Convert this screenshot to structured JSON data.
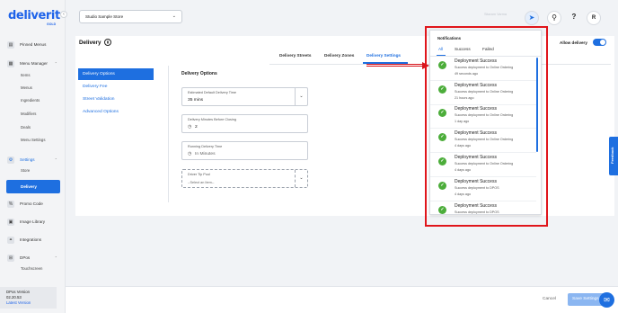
{
  "sidebar": {
    "logo": "deliverit",
    "logo_sub": "GOLD",
    "items": [
      {
        "label": "Pinned Menus",
        "icon": "pin-icon"
      },
      {
        "label": "Menu Manager",
        "icon": "menu-icon"
      },
      {
        "label": "Settings",
        "icon": "gear-icon"
      },
      {
        "label": "Promo Code",
        "icon": "promo-icon"
      },
      {
        "label": "Image Library",
        "icon": "image-icon"
      },
      {
        "label": "Integrations",
        "icon": "integrations-icon"
      },
      {
        "label": "DPos",
        "icon": "dpos-icon"
      }
    ],
    "menu_manager_sub": [
      "Items",
      "Menus",
      "Ingredients",
      "Modifiers",
      "Deals",
      "Menu Settings"
    ],
    "settings_sub": [
      "Store",
      "Delivery"
    ],
    "dpos_sub": [
      "Touchscreen"
    ],
    "version_label": "DPos Version",
    "version_number": "02.20.53",
    "version_link": "Latest Version"
  },
  "topbar": {
    "store_select": "Studio Sample Store",
    "faint_text": "Sitaram Varma"
  },
  "page": {
    "title": "Delivery",
    "tabs": [
      "Delivery Streets",
      "Delivery Zones",
      "Delivery Settings"
    ],
    "active_tab": "Delivery Settings",
    "allow_delivery_label": "Allow delivery",
    "side_tabs": [
      "Delivery Options",
      "Delivery Fee",
      "Street Validation",
      "Advanced Options"
    ],
    "section_title": "Delivery Options",
    "fields": [
      {
        "label": "Estimated Default Delivery Time",
        "value": "35 mins"
      },
      {
        "label": "Delivery Minutes Before Closing",
        "value": "2"
      },
      {
        "label": "Running Delivery Time",
        "value": "In Minutes"
      },
      {
        "label": "Driver Tip Pool",
        "value": "--Select an Item--"
      }
    ]
  },
  "notifications": {
    "header": "Notifications",
    "tabs": [
      "All",
      "Success",
      "Failed"
    ],
    "active_tab": "All",
    "items": [
      {
        "title": "Deployment Success",
        "detail": "Success deployment to Online Ordering",
        "time": "49 seconds ago"
      },
      {
        "title": "Deployment Success",
        "detail": "Success deployment to Online Ordering",
        "time": "21 hours ago"
      },
      {
        "title": "Deployment Success",
        "detail": "Success deployment to Online Ordering",
        "time": "1 day ago"
      },
      {
        "title": "Deployment Success",
        "detail": "Success deployment to Online Ordering",
        "time": "4 days ago"
      },
      {
        "title": "Deployment Success",
        "detail": "Success deployment to Online Ordering",
        "time": "4 days ago"
      },
      {
        "title": "Deployment Success",
        "detail": "Success deployment to DPOS",
        "time": "4 days ago"
      },
      {
        "title": "Deployment Success",
        "detail": "Success deployment to DPOS",
        "time": ""
      }
    ]
  },
  "footer": {
    "cancel_label": "Cancel",
    "save_label": "Save Settings"
  },
  "feedback_label": "Feedback",
  "colors": {
    "accent": "#1e6fe0",
    "success": "#4cad3a",
    "annotation": "#e0151b"
  }
}
